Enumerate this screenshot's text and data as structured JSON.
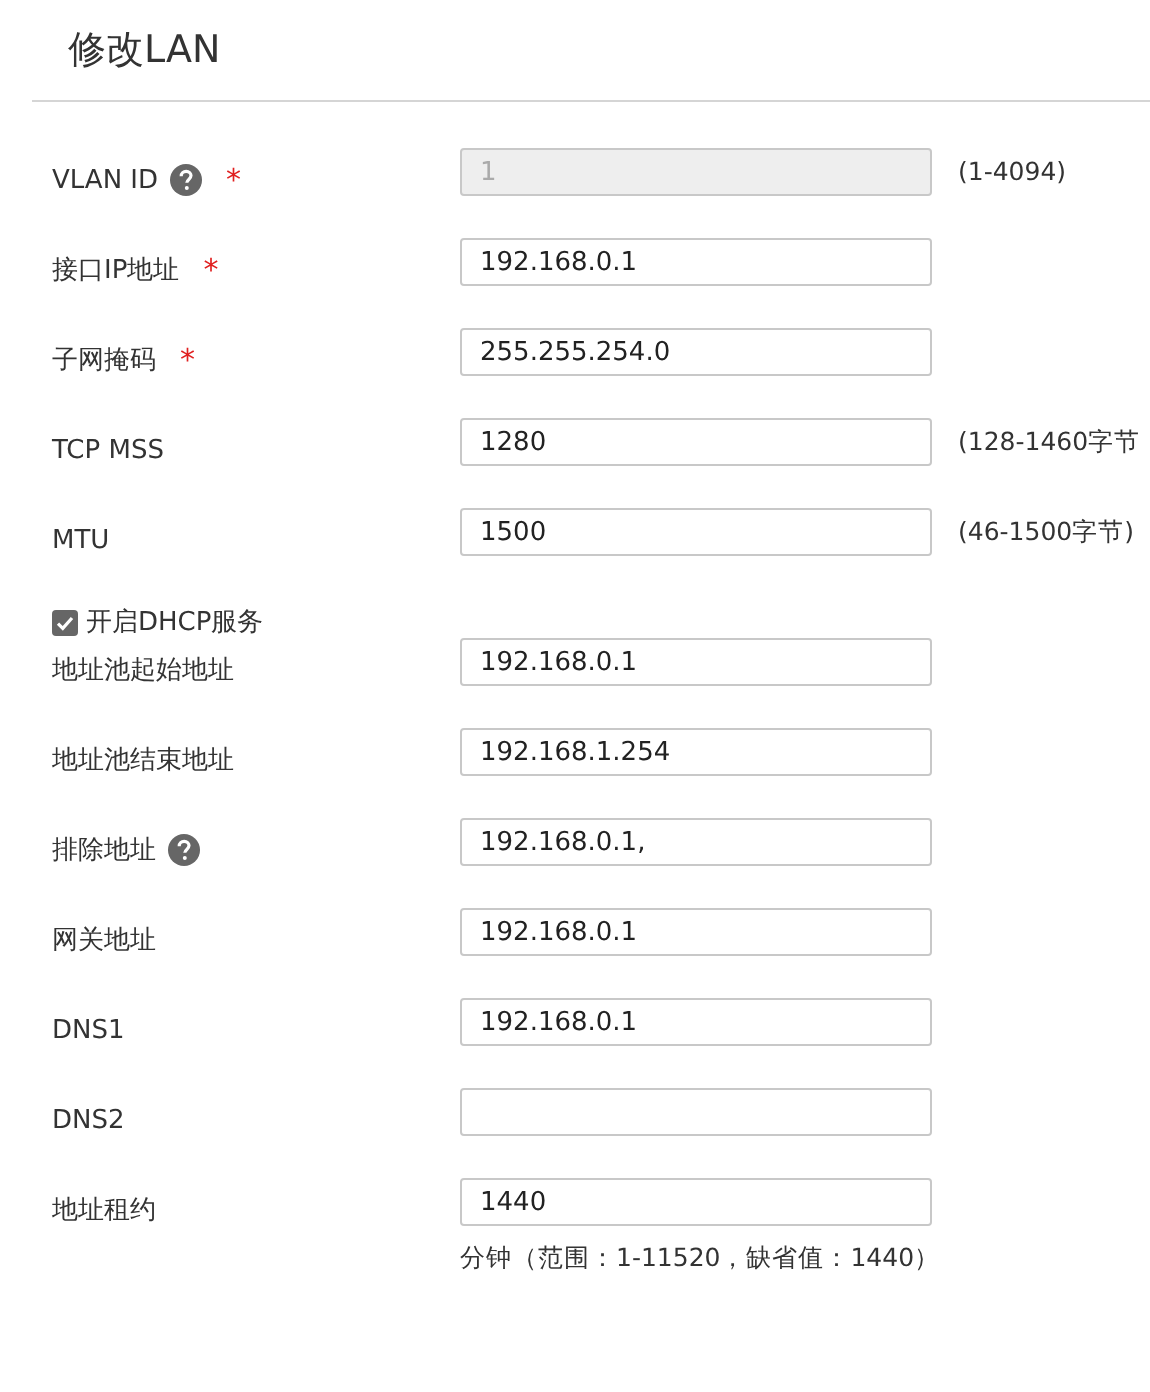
{
  "title": "修改LAN",
  "rows": [
    {
      "kind": "field",
      "label": "VLAN ID",
      "help": true,
      "mark": "*",
      "value": "1",
      "disabled": true,
      "hint": "(1-4094)"
    },
    {
      "kind": "field",
      "label": "接口IP地址",
      "help": false,
      "mark": "*",
      "value": "192.168.0.1",
      "disabled": false
    },
    {
      "kind": "field",
      "label": "子网掩码",
      "help": false,
      "mark": "*",
      "value": "255.255.254.0",
      "disabled": false
    },
    {
      "kind": "field",
      "label": "TCP MSS",
      "help": false,
      "value": "1280",
      "disabled": false,
      "hint": "(128-1460字节"
    },
    {
      "kind": "field",
      "label": "MTU",
      "help": false,
      "value": "1500",
      "disabled": false,
      "hint": "(46-1500字节)"
    },
    {
      "kind": "checkbox",
      "label": "开启DHCP服务",
      "checked": true
    },
    {
      "kind": "field",
      "label": "地址池起始地址",
      "help": false,
      "value": "192.168.0.1",
      "disabled": false
    },
    {
      "kind": "field",
      "label": "地址池结束地址",
      "help": false,
      "value": "192.168.1.254",
      "disabled": false
    },
    {
      "kind": "field",
      "label": "排除地址",
      "help": true,
      "value": "192.168.0.1,",
      "disabled": false
    },
    {
      "kind": "field",
      "label": "网关地址",
      "help": false,
      "value": "192.168.0.1",
      "disabled": false
    },
    {
      "kind": "field",
      "label": "DNS1",
      "help": false,
      "value": "192.168.0.1",
      "disabled": false
    },
    {
      "kind": "field",
      "label": "DNS2",
      "help": false,
      "disabled": false
    },
    {
      "kind": "field",
      "label": "地址租约",
      "help": false,
      "value": "1440",
      "disabled": false,
      "note": "分钟（范围：1-11520，缺省值：1440）"
    }
  ]
}
